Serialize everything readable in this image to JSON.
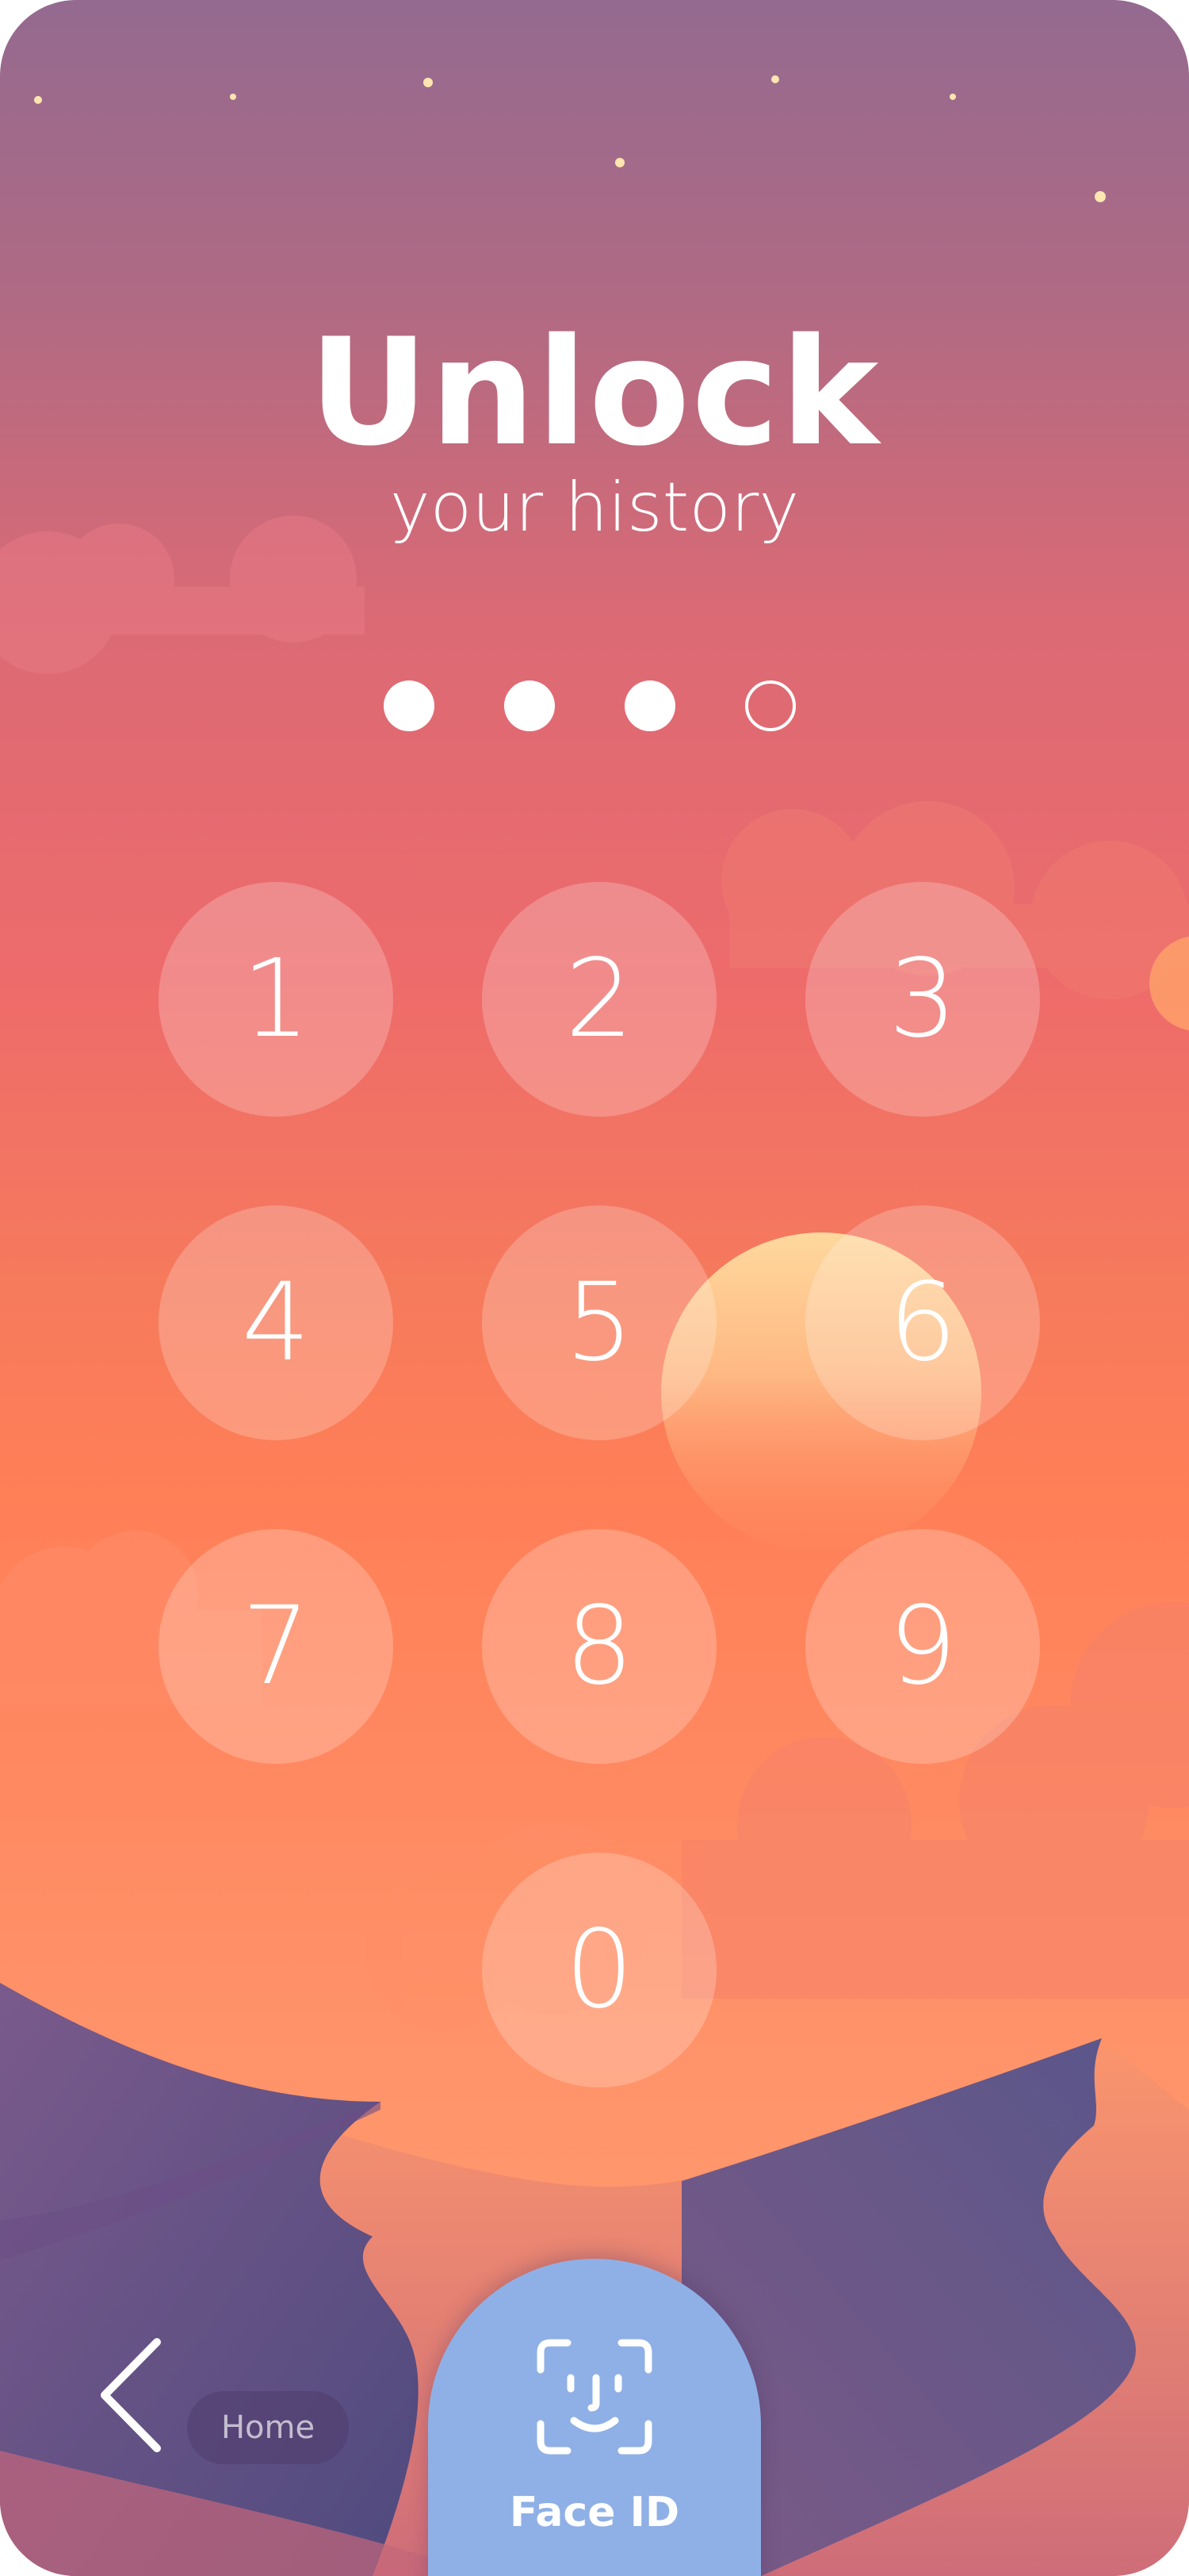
{
  "screen": {
    "title": "Unlock",
    "subtitle": "your history"
  },
  "passcode": {
    "length": 4,
    "entered": 3
  },
  "keypad": {
    "keys": [
      "1",
      "2",
      "3",
      "4",
      "5",
      "6",
      "7",
      "8",
      "9",
      "0"
    ]
  },
  "bottom_bar": {
    "home_label": "Home",
    "face_id_label": "Face ID"
  },
  "icons": {
    "back": "chevron-left-icon",
    "face_id": "face-id-icon"
  },
  "colors": {
    "face_id_button": "#8fb0e6",
    "sky_top": "#946a90",
    "sky_mid": "#ff7f57",
    "dunes": "#5c4f86"
  }
}
